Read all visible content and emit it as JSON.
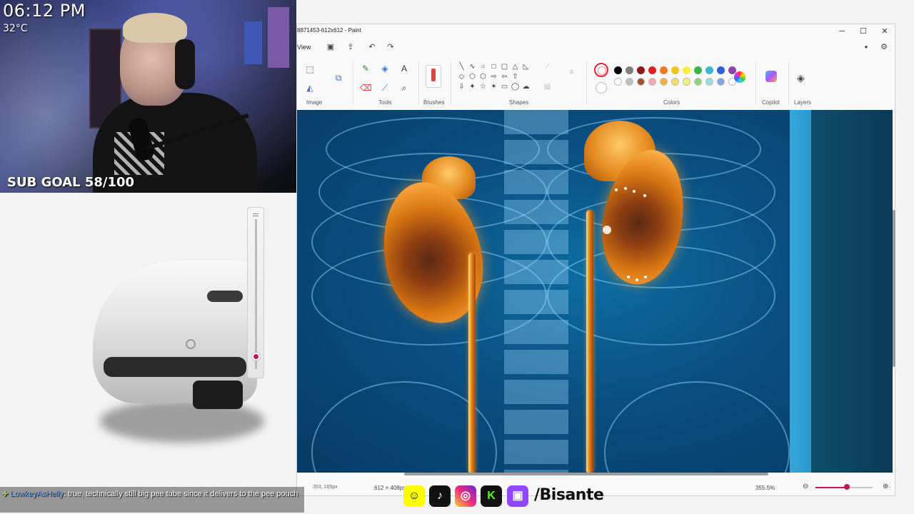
{
  "stream": {
    "time": "06:12 PM",
    "temperature": "32°C",
    "sub_goal": "SUB GOAL 58/100"
  },
  "paint": {
    "title": "8871453-612x612 - Paint",
    "menu": {
      "view": "View"
    },
    "quick_icons": [
      "save-icon",
      "share-icon",
      "undo-icon",
      "redo-icon"
    ],
    "groups": {
      "image": "Image",
      "tools": "Tools",
      "brushes": "Brushes",
      "shapes": "Shapes",
      "colors": "Colors",
      "copilot": "Copilot",
      "layers": "Layers"
    },
    "window_controls": {
      "minimize": "─",
      "maximize": "☐",
      "close": "✕"
    },
    "palette_row1": [
      "#000000",
      "#7f7f7f",
      "#8b1a1a",
      "#e02020",
      "#f07a22",
      "#f4c21b",
      "#f7ee3b",
      "#39b54a",
      "#3cb5d6",
      "#2f5fd9",
      "#8e44ad"
    ],
    "palette_row2": [
      "#ffffff",
      "#bfbfbf",
      "#a0522d",
      "#f1a7b5",
      "#f5b041",
      "#f7dc6f",
      "#e9f57b",
      "#8fd67a",
      "#99dbe9",
      "#7ea4e6",
      "#c39bd3"
    ],
    "status": {
      "cursor": "353, 165px",
      "dimensions": "612 × 408px",
      "zoom": "355.5%",
      "zoom_level": 0.55
    }
  },
  "side_slider_level": 0.08,
  "chat": {
    "user": "LowkeyAsHelly",
    "message": ": true, technically still big pee tube since it delivers to the pee pouch"
  },
  "socials": {
    "handle": "/Bisante",
    "icons": [
      "snapchat-icon",
      "tiktok-icon",
      "instagram-icon",
      "kick-icon",
      "twitch-icon"
    ]
  }
}
